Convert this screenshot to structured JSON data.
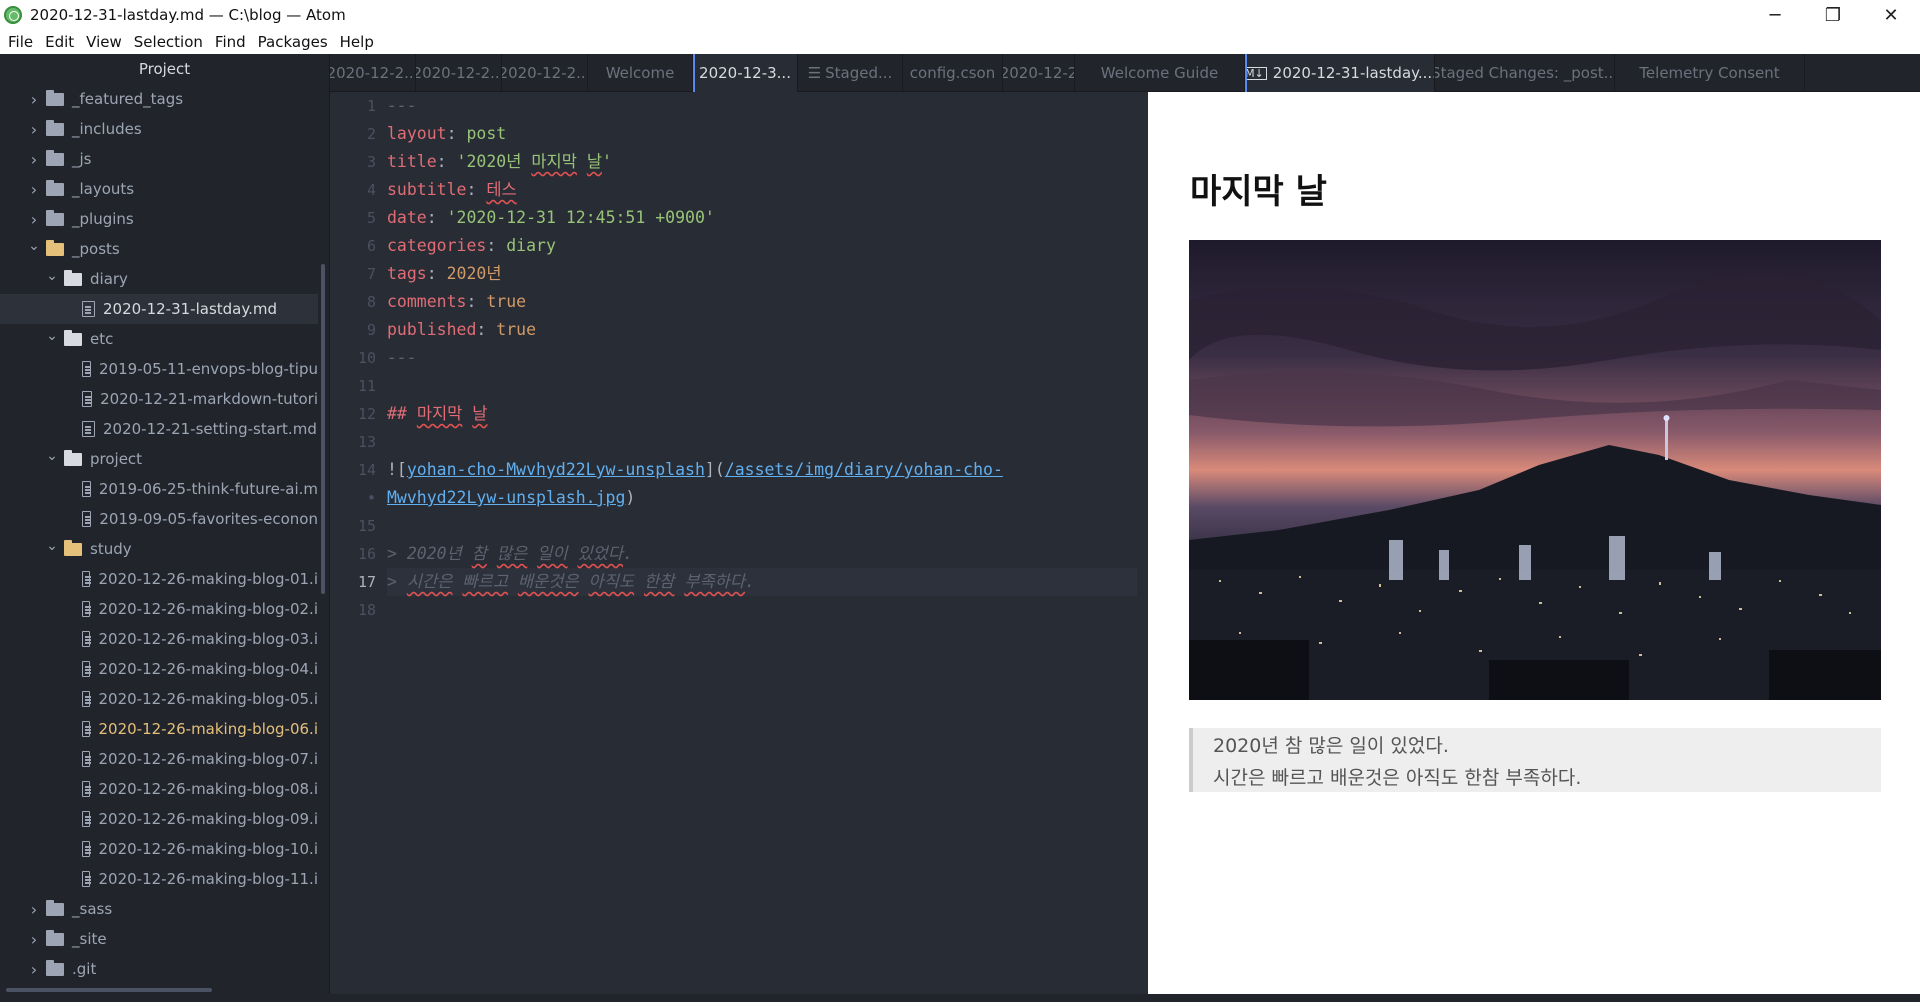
{
  "window": {
    "title": "2020-12-31-lastday.md — C:\\blog — Atom",
    "controls": [
      "─",
      "❐",
      "✕"
    ]
  },
  "menu": [
    "File",
    "Edit",
    "View",
    "Selection",
    "Find",
    "Packages",
    "Help"
  ],
  "tree": {
    "header": "Project",
    "items": [
      {
        "label": "_featured_tags",
        "type": "folder",
        "depth": 0,
        "expanded": false
      },
      {
        "label": "_includes",
        "type": "folder",
        "depth": 0,
        "expanded": false
      },
      {
        "label": "_js",
        "type": "folder",
        "depth": 0,
        "expanded": false
      },
      {
        "label": "_layouts",
        "type": "folder",
        "depth": 0,
        "expanded": false
      },
      {
        "label": "_plugins",
        "type": "folder",
        "depth": 0,
        "expanded": false
      },
      {
        "label": "_posts",
        "type": "folder",
        "depth": 0,
        "expanded": true,
        "color": "yellow"
      },
      {
        "label": "diary",
        "type": "folder",
        "depth": 1,
        "expanded": true
      },
      {
        "label": "2020-12-31-lastday.md",
        "type": "file",
        "depth": 2,
        "selected": true
      },
      {
        "label": "etc",
        "type": "folder",
        "depth": 1,
        "expanded": true
      },
      {
        "label": "2019-05-11-envops-blog-tipu",
        "type": "file",
        "depth": 2
      },
      {
        "label": "2020-12-21-markdown-tutori",
        "type": "file",
        "depth": 2
      },
      {
        "label": "2020-12-21-setting-start.md",
        "type": "file",
        "depth": 2
      },
      {
        "label": "project",
        "type": "folder",
        "depth": 1,
        "expanded": true
      },
      {
        "label": "2019-06-25-think-future-ai.m",
        "type": "file",
        "depth": 2
      },
      {
        "label": "2019-09-05-favorites-econon",
        "type": "file",
        "depth": 2
      },
      {
        "label": "study",
        "type": "folder",
        "depth": 1,
        "expanded": true,
        "color": "yellow"
      },
      {
        "label": "2020-12-26-making-blog-01.i",
        "type": "file",
        "depth": 2
      },
      {
        "label": "2020-12-26-making-blog-02.i",
        "type": "file",
        "depth": 2
      },
      {
        "label": "2020-12-26-making-blog-03.i",
        "type": "file",
        "depth": 2
      },
      {
        "label": "2020-12-26-making-blog-04.i",
        "type": "file",
        "depth": 2
      },
      {
        "label": "2020-12-26-making-blog-05.i",
        "type": "file",
        "depth": 2
      },
      {
        "label": "2020-12-26-making-blog-06.i",
        "type": "file",
        "depth": 2,
        "modified": true
      },
      {
        "label": "2020-12-26-making-blog-07.i",
        "type": "file",
        "depth": 2
      },
      {
        "label": "2020-12-26-making-blog-08.i",
        "type": "file",
        "depth": 2
      },
      {
        "label": "2020-12-26-making-blog-09.i",
        "type": "file",
        "depth": 2
      },
      {
        "label": "2020-12-26-making-blog-10.i",
        "type": "file",
        "depth": 2
      },
      {
        "label": "2020-12-26-making-blog-11.i",
        "type": "file",
        "depth": 2
      },
      {
        "label": "_sass",
        "type": "folder",
        "depth": 0,
        "expanded": false
      },
      {
        "label": "_site",
        "type": "folder",
        "depth": 0,
        "expanded": false
      },
      {
        "label": ".git",
        "type": "folder",
        "depth": 0,
        "expanded": false
      }
    ]
  },
  "tabs": [
    {
      "label": "2020-12-2...",
      "width": 86
    },
    {
      "label": "2020-12-2...",
      "width": 86
    },
    {
      "label": "2020-12-2...",
      "width": 86
    },
    {
      "label": "Welcome",
      "width": 105
    },
    {
      "label": "2020-12-3...",
      "width": 105,
      "active": true
    },
    {
      "label": "Staged...",
      "width": 105,
      "icon": "checklist-icon"
    },
    {
      "label": "config.cson",
      "width": 100
    },
    {
      "label": "2020-12-2",
      "width": 72
    },
    {
      "label": "Welcome Guide",
      "width": 170
    },
    {
      "label": "2020-12-31-lastday....",
      "width": 190,
      "active": true,
      "icon": "preview-icon"
    },
    {
      "label": "Staged Changes: _post...",
      "width": 180
    },
    {
      "label": "Telemetry Consent",
      "width": 190
    }
  ],
  "editor": {
    "current_line": 17,
    "line_numbers": [
      "1",
      "2",
      "3",
      "4",
      "5",
      "6",
      "7",
      "8",
      "9",
      "10",
      "11",
      "12",
      "13",
      "14",
      "•",
      "15",
      "16",
      "17",
      "18"
    ]
  },
  "preview": {
    "heading": "마지막 날",
    "image_alt": "yohan-cho-Mwvhyd22Lyw-unsplash",
    "quote": [
      "2020년 참 많은 일이 있었다.",
      "시간은 빠르고 배운것은 아직도 한참 부족하다."
    ]
  },
  "colors": {
    "editor_bg": "#282c34",
    "panel_bg": "#21252b",
    "accent": "#568af2",
    "keyword": "#e06c75",
    "string": "#98c379",
    "constant": "#d19a66",
    "link": "#61afef",
    "modified": "#e5c07b"
  }
}
